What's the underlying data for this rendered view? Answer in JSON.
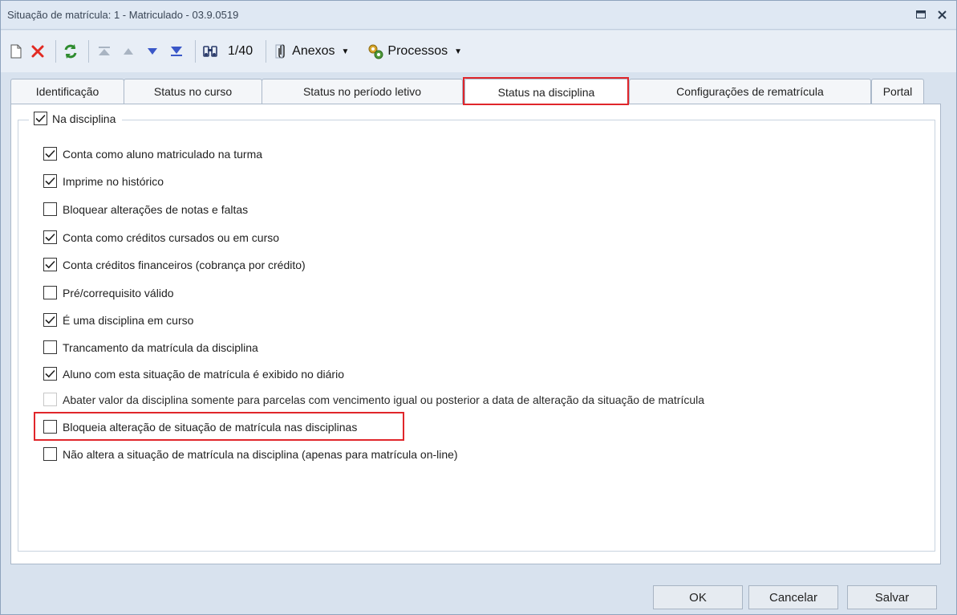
{
  "window": {
    "title": "Situação de matrícula: 1 - Matriculado - 03.9.0519"
  },
  "toolbar": {
    "record_position": "1/40",
    "attachments_label": "Anexos",
    "processes_label": "Processos",
    "icons": [
      "new-icon",
      "delete-icon",
      "refresh-icon",
      "first-record-icon",
      "previous-record-icon",
      "next-record-icon",
      "last-record-icon",
      "binoculars-icon",
      "paperclip-icon",
      "gears-icon"
    ]
  },
  "tabs": [
    {
      "label": "Identificação"
    },
    {
      "label": "Status no curso"
    },
    {
      "label": "Status no período letivo"
    },
    {
      "label": "Status na disciplina"
    },
    {
      "label": "Configurações de rematrícula"
    },
    {
      "label": "Portal"
    }
  ],
  "active_tab": "Status na disciplina",
  "group": {
    "label": "Na disciplina",
    "checked": true
  },
  "options": [
    {
      "label": "Conta como aluno matriculado na turma",
      "checked": true,
      "disabled": false
    },
    {
      "label": "Imprime no histórico",
      "checked": true,
      "disabled": false
    },
    {
      "label": "Bloquear alterações de notas e faltas",
      "checked": false,
      "disabled": false
    },
    {
      "label": "Conta como créditos cursados ou em curso",
      "checked": true,
      "disabled": false
    },
    {
      "label": "Conta créditos financeiros (cobrança por crédito)",
      "checked": true,
      "disabled": false
    },
    {
      "label": "Pré/correquisito válido",
      "checked": false,
      "disabled": false
    },
    {
      "label": "É uma disciplina em curso",
      "checked": true,
      "disabled": false
    },
    {
      "label": "Trancamento da matrícula da disciplina",
      "checked": false,
      "disabled": false
    },
    {
      "label": "Aluno com esta situação de matrícula é exibido no diário",
      "checked": true,
      "disabled": false
    },
    {
      "label": "Abater valor da disciplina somente para parcelas com vencimento igual ou posterior a data de alteração da situação de matrícula",
      "checked": false,
      "disabled": true
    },
    {
      "label": "Bloqueia alteração de situação de matrícula nas disciplinas",
      "checked": false,
      "disabled": false
    },
    {
      "label": "Não altera a situação de matrícula na disciplina (apenas para matrícula on-line)",
      "checked": false,
      "disabled": false
    }
  ],
  "buttons": {
    "ok": "OK",
    "cancel": "Cancelar",
    "save": "Salvar"
  },
  "colors": {
    "highlight": "#e0262b",
    "window_bg": "#d8e2ee"
  }
}
